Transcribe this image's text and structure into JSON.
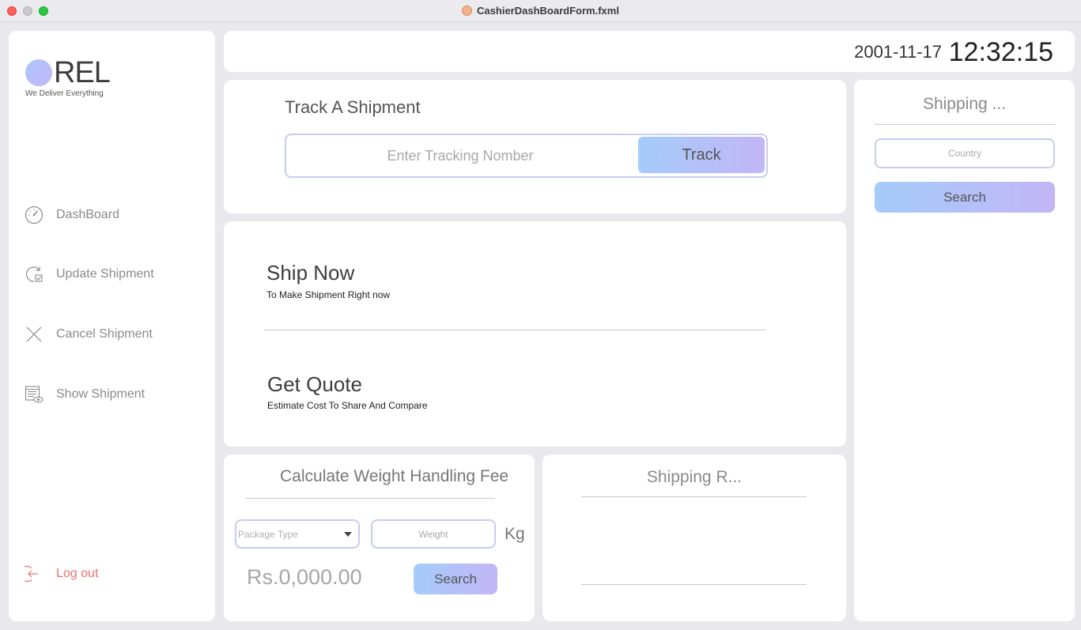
{
  "window": {
    "title": "CashierDashBoardForm.fxml"
  },
  "brand": {
    "name": "REL",
    "tagline": "We Deliver Everything"
  },
  "sidebar": {
    "items": [
      {
        "label": "DashBoard",
        "icon": "speedometer-icon"
      },
      {
        "label": "Update Shipment",
        "icon": "refresh-check-icon"
      },
      {
        "label": "Cancel Shipment",
        "icon": "close-icon"
      },
      {
        "label": "Show Shipment",
        "icon": "list-view-icon"
      }
    ],
    "logout": {
      "label": "Log out",
      "icon": "logout-icon"
    }
  },
  "header": {
    "date": "2001-11-17",
    "time": "12:32:15"
  },
  "track": {
    "title": "Track A Shipment",
    "placeholder": "Enter Tracking Nomber",
    "button": "Track"
  },
  "ship": {
    "ship_now_title": "Ship Now",
    "ship_now_sub": "To Make Shipment Right now",
    "quote_title": "Get Quote",
    "quote_sub": "Estimate Cost To Share And Compare"
  },
  "weight_fee": {
    "title": "Calculate Weight Handling Fee",
    "package_type_placeholder": "Package Type",
    "weight_placeholder": "Weight",
    "unit": "Kg",
    "amount": "Rs.0,000.00",
    "button": "Search"
  },
  "shipping_rates": {
    "title": "Shipping R..."
  },
  "shipping": {
    "title": "Shipping ...",
    "country_placeholder": "Country",
    "button": "Search"
  },
  "colors": {
    "accent_gradient_start": "#a5ccfa",
    "accent_gradient_end": "#c2b5f6",
    "logout": "#f07070",
    "input_border": "#c6ccf2"
  }
}
